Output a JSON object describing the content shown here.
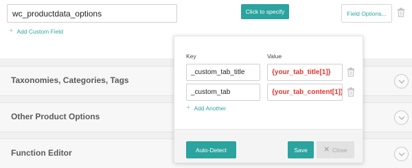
{
  "custom_field": {
    "name_value": "wc_productdata_options",
    "add_link": "Add Custom Field",
    "specify_button": "Click to specify",
    "options_button": "Field Options..."
  },
  "sections": [
    {
      "title": "Taxonomies, Categories, Tags"
    },
    {
      "title": "Other Product Options"
    },
    {
      "title": "Function Editor"
    }
  ],
  "popup": {
    "key_header": "Key",
    "value_header": "Value",
    "rows": [
      {
        "key": "_custom_tab_title",
        "value": "{your_tab_title[1]}"
      },
      {
        "key": "_custom_tab",
        "value": "{your_tab_content[1]}"
      }
    ],
    "add_another": "Add Another",
    "auto_detect": "Auto-Detect",
    "save": "Save",
    "close": "Close"
  },
  "colors": {
    "accent": "#2ba39e",
    "link": "#2aa6a0",
    "value_text": "#e0342d"
  },
  "icons": [
    "plus-icon",
    "trash-icon",
    "chevron-down-icon",
    "close-icon"
  ]
}
